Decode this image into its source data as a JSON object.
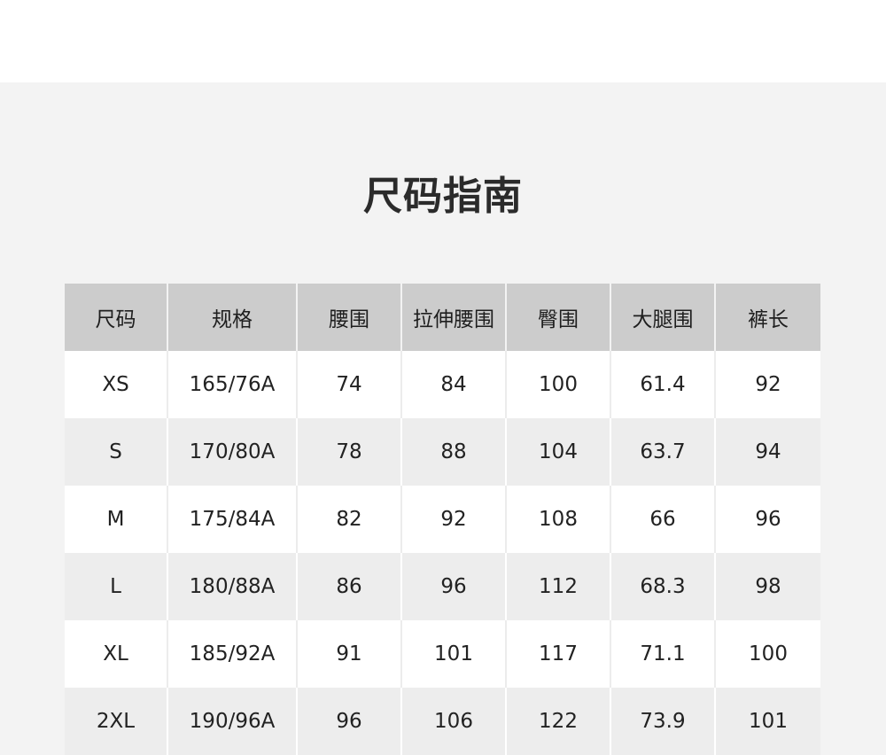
{
  "title": "尺码指南",
  "table": {
    "headers": [
      "尺码",
      "规格",
      "腰围",
      "拉伸腰围",
      "臀围",
      "大腿围",
      "裤长"
    ],
    "rows": [
      [
        "XS",
        "165/76A",
        "74",
        "84",
        "100",
        "61.4",
        "92"
      ],
      [
        "S",
        "170/80A",
        "78",
        "88",
        "104",
        "63.7",
        "94"
      ],
      [
        "M",
        "175/84A",
        "82",
        "92",
        "108",
        "66",
        "96"
      ],
      [
        "L",
        "180/88A",
        "86",
        "96",
        "112",
        "68.3",
        "98"
      ],
      [
        "XL",
        "185/92A",
        "91",
        "101",
        "117",
        "71.1",
        "100"
      ],
      [
        "2XL",
        "190/96A",
        "96",
        "106",
        "122",
        "73.9",
        "101"
      ]
    ]
  },
  "colors": {
    "page_background": "#ffffff",
    "panel_background": "#f3f3f3",
    "header_background": "#cccccc",
    "row_alt_background": "#ededed",
    "title_color": "#2b2b2b"
  }
}
